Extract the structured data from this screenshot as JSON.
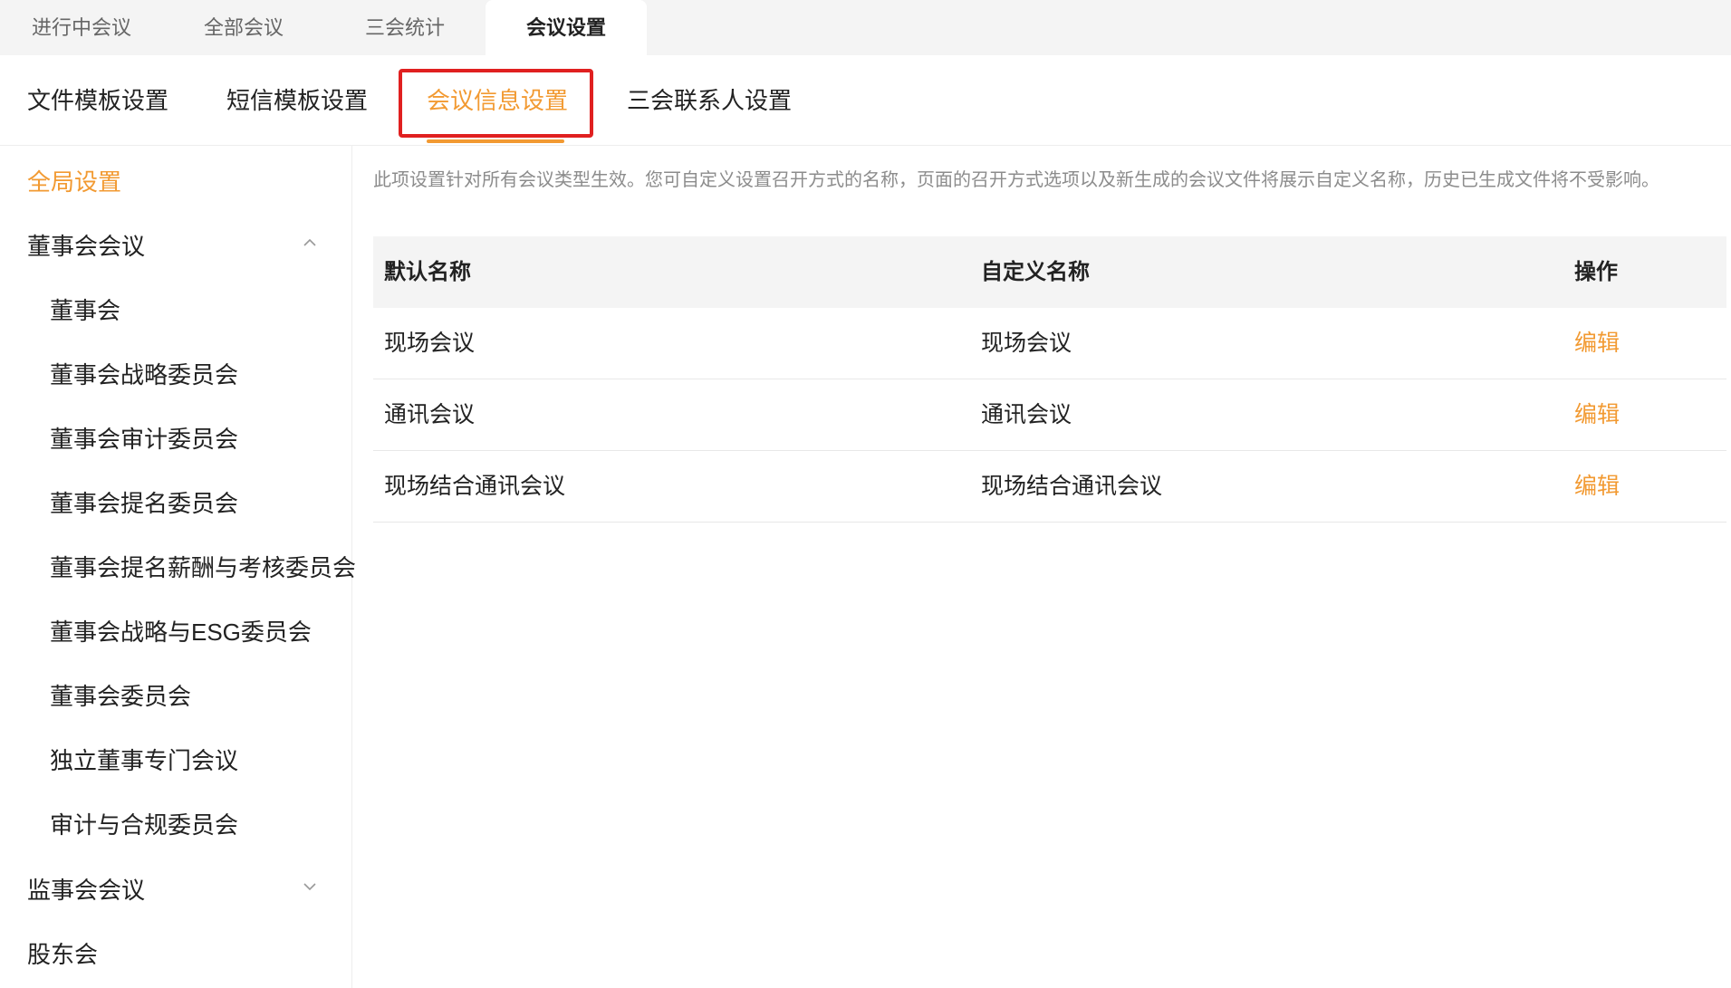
{
  "top_tabs": [
    {
      "label": "进行中会议"
    },
    {
      "label": "全部会议"
    },
    {
      "label": "三会统计"
    },
    {
      "label": "会议设置"
    }
  ],
  "sub_tabs": [
    {
      "label": "文件模板设置"
    },
    {
      "label": "短信模板设置"
    },
    {
      "label": "会议信息设置"
    },
    {
      "label": "三会联系人设置"
    }
  ],
  "sidebar": {
    "global": "全局设置",
    "board_group": "董事会会议",
    "board_items": [
      "董事会",
      "董事会战略委员会",
      "董事会审计委员会",
      "董事会提名委员会",
      "董事会提名薪酬与考核委员会",
      "董事会战略与ESG委员会",
      "董事会委员会",
      "独立董事专门会议",
      "审计与合规委员会"
    ],
    "supervisory_group": "监事会会议",
    "shareholders": "股东会"
  },
  "main": {
    "description": "此项设置针对所有会议类型生效。您可自定义设置召开方式的名称，页面的召开方式选项以及新生成的会议文件将展示自定义名称，历史已生成文件将不受影响。",
    "columns": [
      "默认名称",
      "自定义名称",
      "操作"
    ],
    "rows": [
      {
        "default_name": "现场会议",
        "custom_name": "现场会议",
        "action": "编辑"
      },
      {
        "default_name": "通讯会议",
        "custom_name": "通讯会议",
        "action": "编辑"
      },
      {
        "default_name": "现场结合通讯会议",
        "custom_name": "现场结合通讯会议",
        "action": "编辑"
      }
    ]
  },
  "colors": {
    "accent": "#f29a32",
    "highlight": "#e02020",
    "tab_bar_bg": "#f4f4f4"
  }
}
